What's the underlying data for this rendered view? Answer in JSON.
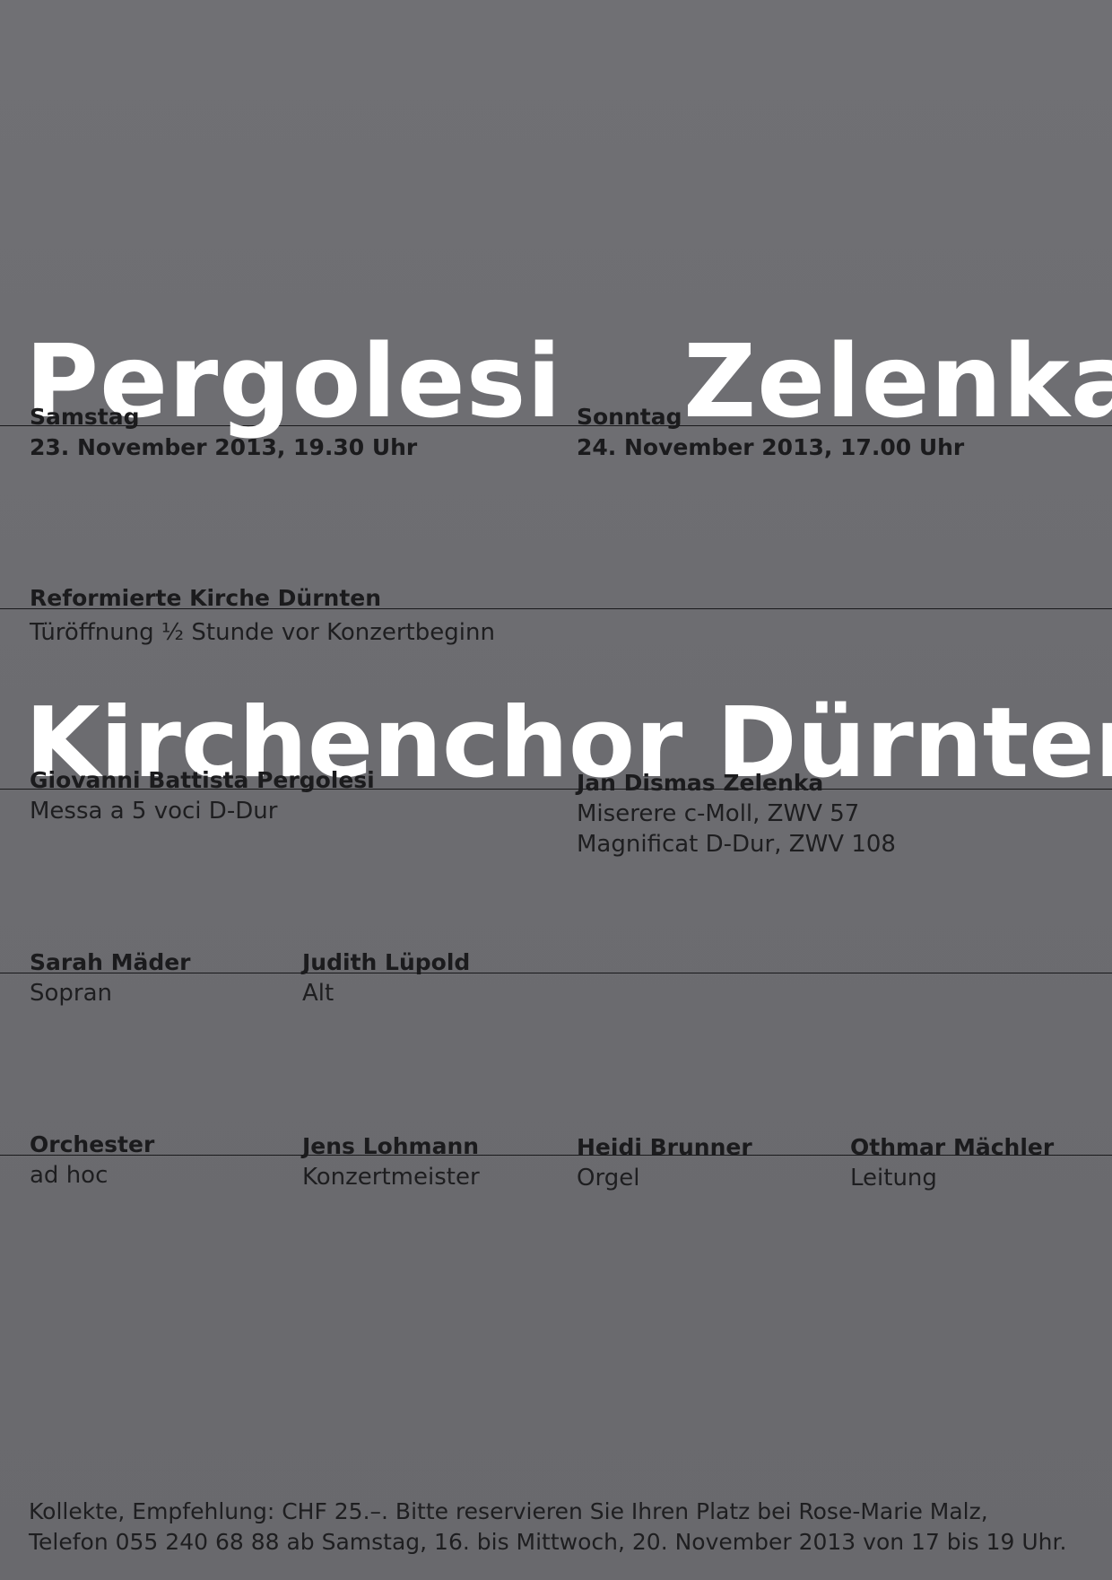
{
  "headings": {
    "left_composer": "Pergolesi",
    "right_composer": "Zelenka",
    "choir": "Kirchenchor Dürnten"
  },
  "concerts": [
    {
      "day": "Samstag",
      "datetime": "23. November 2013, 19.30 Uhr"
    },
    {
      "day": "Sonntag",
      "datetime": "24. November 2013, 17.00 Uhr"
    }
  ],
  "venue": {
    "name": "Reformierte Kirche Dürnten",
    "note": "Türöffnung ½ Stunde vor Konzertbeginn"
  },
  "program": [
    {
      "composer": "Giovanni Battista Pergolesi",
      "works": [
        "Messa a 5 voci D-Dur"
      ]
    },
    {
      "composer": "Jan Dismas Zelenka",
      "works": [
        "Miserere c-Moll, ZWV 57",
        "Magnificat D-Dur, ZWV 108"
      ]
    }
  ],
  "soloists": [
    {
      "name": "Sarah Mäder",
      "role": "Sopran"
    },
    {
      "name": "Judith Lüpold",
      "role": "Alt"
    }
  ],
  "ensemble": [
    {
      "name": "Orchester",
      "role": "ad hoc"
    },
    {
      "name": "Jens Lohmann",
      "role": "Konzertmeister"
    },
    {
      "name": "Heidi Brunner",
      "role": "Orgel"
    },
    {
      "name": "Othmar Mächler",
      "role": "Leitung"
    }
  ],
  "footer": {
    "line1": "Kollekte, Empfehlung: CHF 25.–. Bitte reservieren Sie Ihren Platz bei Rose-Marie Malz,",
    "line2": "Telefon 055 240 68 88 ab Samstag, 16. bis Mittwoch, 20. November 2013 von 17 bis 19 Uhr."
  }
}
